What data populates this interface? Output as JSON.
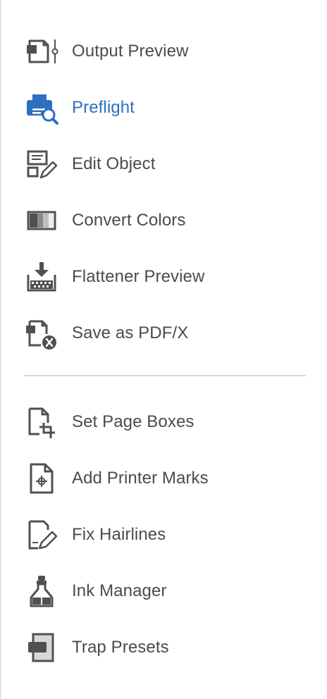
{
  "tools_group_1": [
    {
      "label": "Output Preview",
      "icon": "output-preview-icon",
      "active": false
    },
    {
      "label": "Preflight",
      "icon": "preflight-icon",
      "active": true
    },
    {
      "label": "Edit Object",
      "icon": "edit-object-icon",
      "active": false
    },
    {
      "label": "Convert Colors",
      "icon": "convert-colors-icon",
      "active": false
    },
    {
      "label": "Flattener Preview",
      "icon": "flattener-preview-icon",
      "active": false
    },
    {
      "label": "Save as PDF/X",
      "icon": "save-as-pdfx-icon",
      "active": false
    }
  ],
  "tools_group_2": [
    {
      "label": "Set Page Boxes",
      "icon": "set-page-boxes-icon",
      "active": false
    },
    {
      "label": "Add Printer Marks",
      "icon": "add-printer-marks-icon",
      "active": false
    },
    {
      "label": "Fix Hairlines",
      "icon": "fix-hairlines-icon",
      "active": false
    },
    {
      "label": "Ink Manager",
      "icon": "ink-manager-icon",
      "active": false
    },
    {
      "label": "Trap Presets",
      "icon": "trap-presets-icon",
      "active": false
    }
  ],
  "colors": {
    "active": "#2d6fc1",
    "text": "#4b4b4b",
    "icon": "#505050"
  }
}
